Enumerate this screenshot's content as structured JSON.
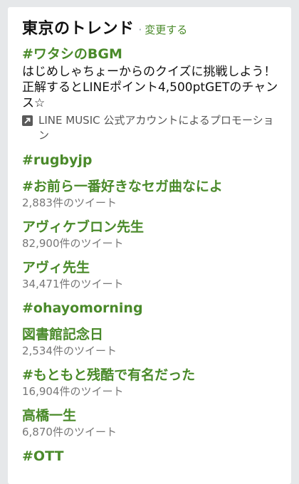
{
  "header": {
    "title": "東京のトレンド",
    "separator": "·",
    "change_label": "変更する"
  },
  "colors": {
    "accent": "#4a8a2a",
    "text": "#111111",
    "muted": "#777777",
    "background": "#e6e8ea"
  },
  "trends": [
    {
      "name": "#ワタシのBGM",
      "description": "はじめしゃちょーからのクイズに挑戦しよう！正解するとLINEポイント4,500ptGETのチャンス☆",
      "promo_icon": "promoted-arrow-icon",
      "promo": "LINE MUSIC 公式アカウントによるプロモーション"
    },
    {
      "name": "#rugbyjp"
    },
    {
      "name": "#お前ら一番好きなセガ曲なによ",
      "count": "2,883件のツイート"
    },
    {
      "name": "アヴィケブロン先生",
      "count": "82,900件のツイート"
    },
    {
      "name": "アヴィ先生",
      "count": "34,471件のツイート"
    },
    {
      "name": "#ohayomorning"
    },
    {
      "name": "図書館記念日",
      "count": "2,534件のツイート"
    },
    {
      "name": "#もともと残酷で有名だった",
      "count": "16,904件のツイート"
    },
    {
      "name": "高橋一生",
      "count": "6,870件のツイート"
    },
    {
      "name": "#OTT"
    }
  ]
}
